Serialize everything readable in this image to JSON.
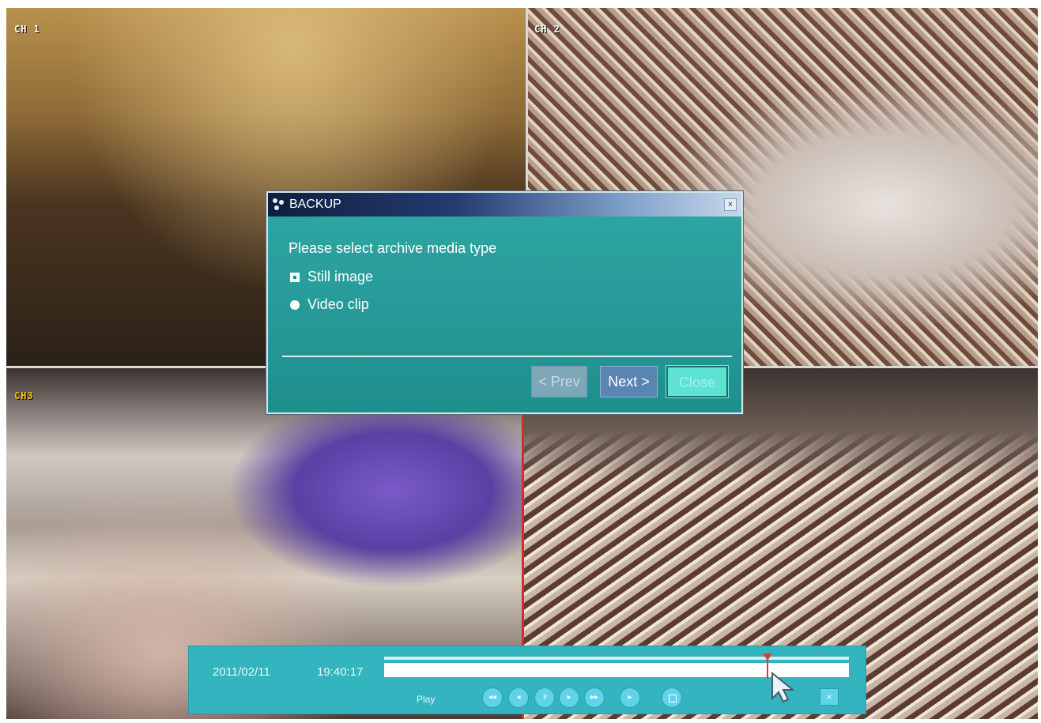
{
  "cameras": {
    "ch1": "CH 1",
    "ch2": "CH 2",
    "ch3": "CH3"
  },
  "dialog": {
    "title": "BACKUP",
    "close_icon": "×",
    "prompt": "Please select archive media type",
    "options": [
      {
        "label": "Still image",
        "selected": true
      },
      {
        "label": "Video clip",
        "selected": false
      }
    ],
    "buttons": {
      "prev": "< Prev",
      "next": "Next >",
      "close": "Close"
    }
  },
  "playback": {
    "date": "2011/02/11",
    "time": "19:40:17",
    "mode": "Play",
    "progress": 0.83,
    "controls": {
      "rewind": "◂◂",
      "step_back": "◂",
      "pause": "॥",
      "step_forward": "▸",
      "fast_forward": "▸▸",
      "play": "▸"
    },
    "close_icon": "×"
  },
  "colors": {
    "dialog_bg": "#1f8f8e",
    "playback_bg": "#34b4bf",
    "ch3_label": "#f5c400",
    "marker": "#e23a3a"
  }
}
